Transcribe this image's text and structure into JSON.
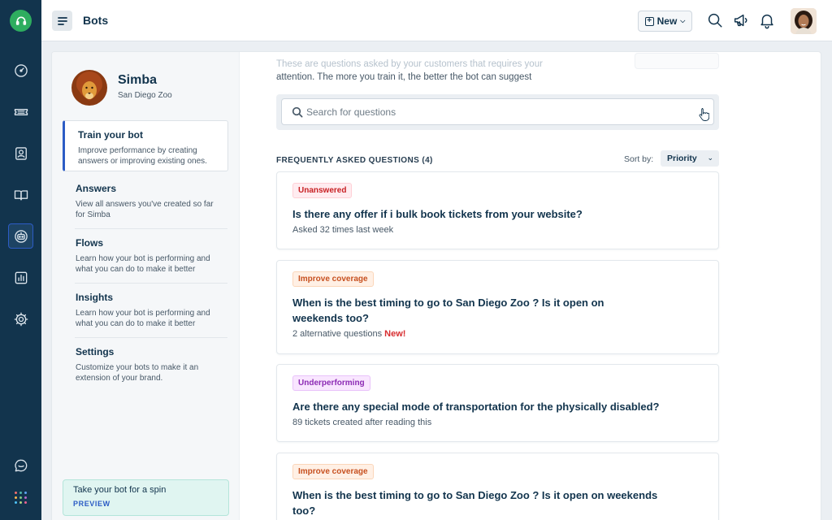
{
  "header": {
    "title": "Bots",
    "new_label": "New"
  },
  "bot": {
    "name": "Simba",
    "location": "San Diego Zoo"
  },
  "subnav": [
    {
      "title": "Train your bot",
      "desc": "Improve performance by creating answers or improving existing ones."
    },
    {
      "title": "Answers",
      "desc": "View all answers you've created so far for Simba"
    },
    {
      "title": "Flows",
      "desc": "Learn how your bot is performing and what you can do to make it better"
    },
    {
      "title": "Insights",
      "desc": "Learn how your bot is performing and what you can do to make it better"
    },
    {
      "title": "Settings",
      "desc": "Customize your bots to make it an extension of your brand."
    }
  ],
  "spin": {
    "text": "Take your bot for a spin",
    "preview": "PREVIEW"
  },
  "intro": {
    "line1": "These are questions asked by your customers that requires your",
    "line2": "attention. The more you train it, the better the bot can suggest"
  },
  "search": {
    "placeholder": "Search for questions"
  },
  "faq": {
    "heading": "FREQUENTLY ASKED QUESTIONS (4)",
    "sort_label": "Sort by:",
    "sort_value": "Priority"
  },
  "questions": [
    {
      "badge": "Unanswered",
      "title": "Is there any offer if i bulk book tickets from your website?",
      "meta": "Asked 32 times last week"
    },
    {
      "badge": "Improve coverage",
      "title": "When is the best timing to go to San Diego Zoo ? Is it open on weekends too?",
      "meta": "2 alternative questions",
      "meta_new": "New!"
    },
    {
      "badge": "Underperforming",
      "title": "Are there any special mode of transportation for the physically disabled?",
      "meta": "89 tickets created after reading this"
    },
    {
      "badge": "Improve coverage",
      "title": "When is the best timing to go to San Diego Zoo ? Is it open on weekends too?"
    }
  ],
  "colors": {
    "rail": "#12344d",
    "accent": "#2c5cc5",
    "brand_green": "#2ead5f",
    "badge_red": "#c82124",
    "badge_orange": "#c7501f",
    "badge_purple": "#8c2bb4"
  },
  "icons": {
    "rail": [
      "headset-logo-icon",
      "dashboard-icon",
      "ticket-icon",
      "contacts-icon",
      "book-icon",
      "bot-icon",
      "reports-icon",
      "settings-icon",
      "chat-icon",
      "apps-grid-icon"
    ],
    "topbar": [
      "menu-icon",
      "search-icon",
      "megaphone-icon",
      "bell-icon"
    ]
  }
}
